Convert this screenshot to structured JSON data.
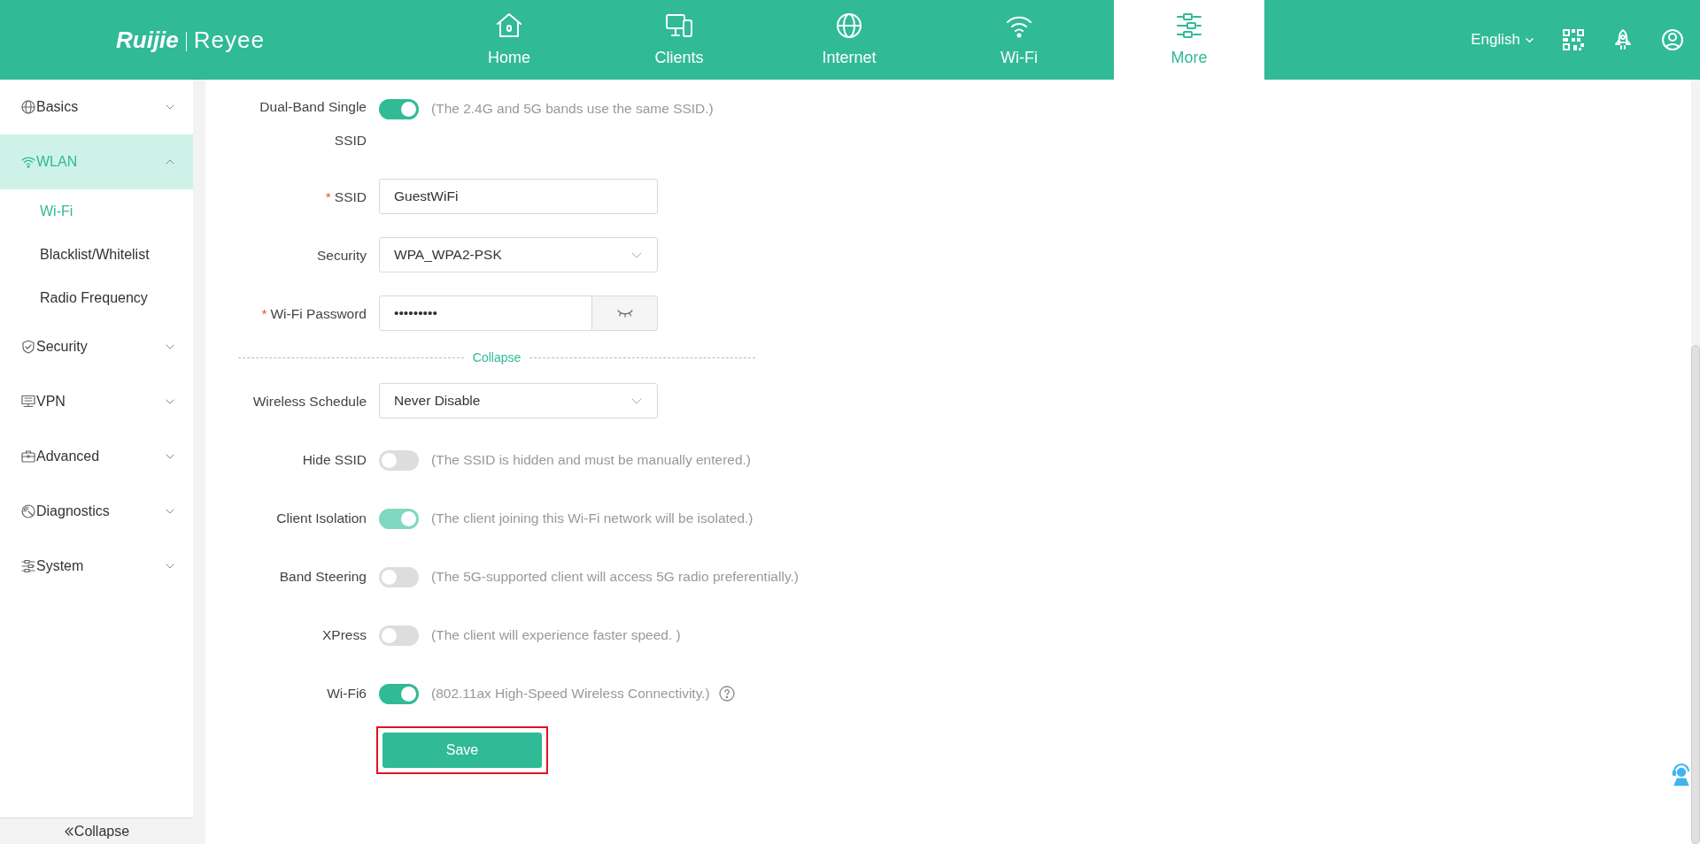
{
  "header": {
    "logo": {
      "brand": "Ruijie",
      "product": "Reyee"
    },
    "nav": [
      {
        "label": "Home",
        "selected": false
      },
      {
        "label": "Clients",
        "selected": false
      },
      {
        "label": "Internet",
        "selected": false
      },
      {
        "label": "Wi-Fi",
        "selected": false
      },
      {
        "label": "More",
        "selected": true
      }
    ],
    "language": "English"
  },
  "sidebar": {
    "items": [
      {
        "label": "Basics",
        "expanded": false,
        "selected": false
      },
      {
        "label": "WLAN",
        "expanded": true,
        "selected": true,
        "children": [
          {
            "label": "Wi-Fi",
            "selected": true
          },
          {
            "label": "Blacklist/Whitelist",
            "selected": false
          },
          {
            "label": "Radio Frequency",
            "selected": false
          }
        ]
      },
      {
        "label": "Security",
        "expanded": false,
        "selected": false
      },
      {
        "label": "VPN",
        "expanded": false,
        "selected": false
      },
      {
        "label": "Advanced",
        "expanded": false,
        "selected": false
      },
      {
        "label": "Diagnostics",
        "expanded": false,
        "selected": false
      },
      {
        "label": "System",
        "expanded": false,
        "selected": false
      }
    ],
    "collapse": "Collapse"
  },
  "form": {
    "rows": [
      {
        "kind": "toggle",
        "label": "Dual-Band Single SSID",
        "on": true,
        "disabled": false,
        "hint": "(The 2.4G and 5G bands use the same SSID.)"
      },
      {
        "kind": "text",
        "label": "SSID",
        "required_mark": "*",
        "value": "GuestWiFi"
      },
      {
        "kind": "select",
        "label": "Security",
        "value": "WPA_WPA2-PSK"
      },
      {
        "kind": "password",
        "label": "Wi-Fi Password",
        "required_mark": "*",
        "value": "•••••••••"
      },
      {
        "kind": "divider",
        "label": "Collapse"
      },
      {
        "kind": "select",
        "label": "Wireless Schedule",
        "value": "Never Disable"
      },
      {
        "kind": "toggle",
        "label": "Hide SSID",
        "on": false,
        "disabled": false,
        "hint": "(The SSID is hidden and must be manually entered.)"
      },
      {
        "kind": "toggle",
        "label": "Client Isolation",
        "on": true,
        "disabled": true,
        "hint": "(The client joining this Wi-Fi network will be isolated.)"
      },
      {
        "kind": "toggle",
        "label": "Band Steering",
        "on": false,
        "disabled": false,
        "hint": "(The 5G-supported client will access 5G radio preferentially.)"
      },
      {
        "kind": "toggle",
        "label": "XPress",
        "on": false,
        "disabled": false,
        "hint": "(The client will experience faster speed. )"
      },
      {
        "kind": "toggle",
        "label": "Wi-Fi6",
        "on": true,
        "disabled": false,
        "hint": "(802.11ax High-Speed Wireless Connectivity.)",
        "help": true
      }
    ],
    "save": {
      "label": "Save",
      "highlighted": true
    }
  }
}
